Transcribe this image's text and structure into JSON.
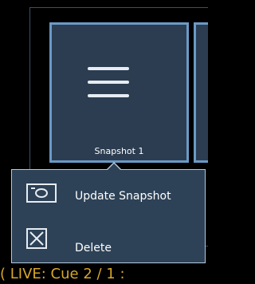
{
  "tiles": [
    {
      "label": "Snapshot 1",
      "icon": "hamburger-menu-icon"
    }
  ],
  "context_menu": {
    "items": [
      {
        "label": "Update Snapshot",
        "icon": "camera-icon"
      },
      {
        "label": "Delete",
        "icon": "close-box-icon"
      }
    ]
  },
  "status_bar": {
    "text": "( LIVE: Cue  2 / 1 :"
  },
  "colors": {
    "background": "#000000",
    "tile_fill": "#2c3d51",
    "tile_border": "#6b9ac6",
    "popup_fill": "#2d4257",
    "popup_border": "#b9c8d8",
    "status_text": "#d6a72a"
  }
}
